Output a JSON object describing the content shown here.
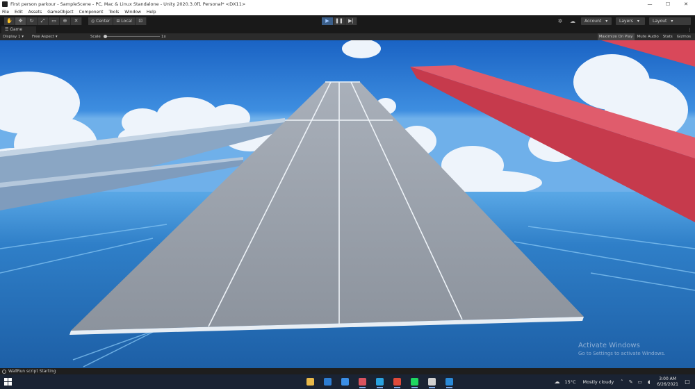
{
  "window": {
    "title": "First person parkour - SampleScene - PC, Mac & Linux Standalone - Unity 2020.3.0f1 Personal* <DX11>",
    "controls": [
      "—",
      "☐",
      "✕"
    ]
  },
  "menu": {
    "items": [
      "File",
      "Edit",
      "Assets",
      "GameObject",
      "Component",
      "Tools",
      "Window",
      "Help"
    ]
  },
  "toolbar": {
    "tools": [
      "hand-tool",
      "move-tool",
      "rotate-tool",
      "scale-tool",
      "rect-tool",
      "transform-tool",
      "custom-tool"
    ],
    "pivot_label": "Center",
    "space_label": "Local",
    "account_label": "Account",
    "layers_label": "Layers",
    "layout_label": "Layout"
  },
  "game_tab": {
    "label": "Game"
  },
  "game_bar": {
    "display": "Display 1",
    "aspect": "Free Aspect",
    "scale_label": "Scale",
    "scale_value": "1x",
    "options": [
      "Maximize On Play",
      "Mute Audio",
      "Stats",
      "Gizmos"
    ]
  },
  "watermark": {
    "title": "Activate Windows",
    "subtitle": "Go to Settings to activate Windows."
  },
  "status": {
    "message": "WallRun script Starting"
  },
  "taskbar": {
    "apps": [
      {
        "name": "file-explorer",
        "color": "#e8b84a",
        "running": false
      },
      {
        "name": "microsoft-store",
        "color": "#2d7dd2",
        "running": false
      },
      {
        "name": "mail",
        "color": "#3a8ee6",
        "running": false
      },
      {
        "name": "browser",
        "color": "#d9535f",
        "running": true
      },
      {
        "name": "telegram",
        "color": "#2aa3e0",
        "running": true
      },
      {
        "name": "chrome",
        "color": "#e04a3a",
        "running": true
      },
      {
        "name": "spotify",
        "color": "#1ed760",
        "running": true
      },
      {
        "name": "unity",
        "color": "#d0d0d0",
        "running": true
      },
      {
        "name": "visual-studio-code",
        "color": "#2a8ad8",
        "running": true
      }
    ],
    "temperature": "15°C",
    "weather": "Mostly cloudy",
    "time": "3:00 AM",
    "date": "6/26/2021"
  },
  "colors": {
    "editor_bg": "#191919",
    "play_active": "#3b5f8a",
    "sky_top": "#1b6cc9",
    "platform_gray": "#9aa1ab",
    "wall_red": "#d9485a",
    "wall_blue": "#8aa6c4"
  }
}
